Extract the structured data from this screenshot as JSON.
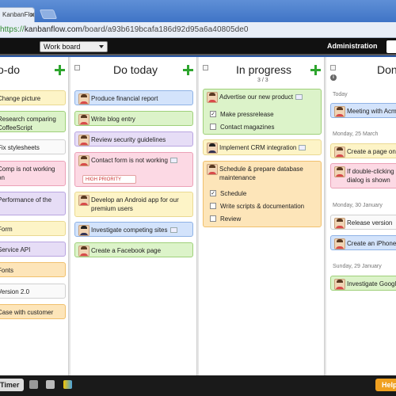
{
  "browser": {
    "tab_title": "KanbanFlow",
    "url_scheme": "https://",
    "url_host": "kanbanflow.com",
    "url_path": "/board/a93b619bcafa186d92d95a6a40805de0"
  },
  "topbar": {
    "board_name": "Work board",
    "administration_label": "Administration"
  },
  "columns": {
    "todo": {
      "title": "To-do",
      "cards": [
        "Change picture",
        "Research comparing CoffeeScript",
        "Fix stylesheets",
        "Comp is not working on",
        "Performance of the",
        "Form",
        "Service API",
        "Fonts",
        "Version 2.0",
        "Case with customer data"
      ]
    },
    "today": {
      "title": "Do today",
      "cards": [
        "Produce financial report",
        "Write blog entry",
        "Review security guidelines",
        "Contact form is not working",
        "Develop an Android app for our premium users",
        "Investigate competing sites",
        "Create a Facebook page"
      ],
      "priority_label": "HIGH PRIORITY"
    },
    "progress": {
      "title": "In progress",
      "wip": "3 / 3",
      "card1": "Advertise our new product",
      "card1_subtasks": [
        "Make pressrelease",
        "Contact magazines"
      ],
      "card2": "Implement CRM integration",
      "card3": "Schedule & prepare database maintenance",
      "card3_subtasks": [
        "Schedule",
        "Write scripts & documentation",
        "Review"
      ]
    },
    "done": {
      "title": "Done",
      "groups": [
        {
          "day": "Today",
          "cards": [
            "Meeting with Acme"
          ]
        },
        {
          "day": "Monday, 25 March",
          "cards": [
            "Create a page on",
            "If double-clicking error dialog is shown"
          ]
        },
        {
          "day": "Monday, 30 January",
          "cards": [
            "Release version",
            "Create an iPhone"
          ]
        },
        {
          "day": "Sunday, 29 January",
          "cards": [
            "Investigate Google"
          ]
        }
      ]
    }
  },
  "footer": {
    "timer_label": "Timer",
    "help_label": "Help"
  },
  "colors": {
    "yellow": "#fdf4c7",
    "green": "#dcf3c9",
    "blue": "#d3e3fb",
    "purple": "#e6ddf6",
    "red": "#fcd9e4",
    "orange": "#fde5b9",
    "add_green": "#2ea52e"
  }
}
